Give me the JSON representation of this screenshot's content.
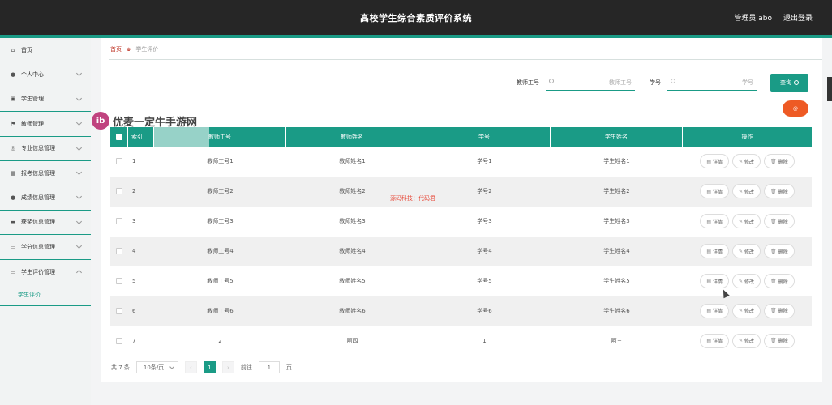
{
  "header": {
    "title": "高校学生综合素质评价系统",
    "user": "管理员 abo",
    "logout": "退出登录"
  },
  "sidebar": {
    "items": [
      {
        "label": "首页",
        "icon": "home-icon"
      },
      {
        "label": "个人中心",
        "icon": "user-icon"
      },
      {
        "label": "学生管理",
        "icon": "student-icon"
      },
      {
        "label": "教师管理",
        "icon": "flag-icon"
      },
      {
        "label": "专业信息管理",
        "icon": "compass-icon"
      },
      {
        "label": "报考信息管理",
        "icon": "grid-icon"
      },
      {
        "label": "成绩信息管理",
        "icon": "user-icon"
      },
      {
        "label": "获奖信息管理",
        "icon": "award-icon"
      },
      {
        "label": "学分信息管理",
        "icon": "monitor-icon"
      },
      {
        "label": "学生评价管理",
        "icon": "monitor-icon"
      }
    ],
    "sub_item": "学生评价"
  },
  "breadcrumb": {
    "home": "首页",
    "current": "学生评价"
  },
  "search": {
    "teacher_no_label": "教师工号",
    "teacher_no_placeholder": "教师工号",
    "student_no_label": "学号",
    "student_no_placeholder": "学号",
    "button": "查询"
  },
  "delete_button": "@",
  "watermark": {
    "logo": "ib",
    "text": "优麦一定牛手游网",
    "center": "源码科技：代码君"
  },
  "table": {
    "headers": [
      "索引",
      "教师工号",
      "教师姓名",
      "学号",
      "学生姓名",
      "操作"
    ],
    "rows": [
      [
        "1",
        "教师工号1",
        "教师姓名1",
        "学号1",
        "学生姓名1"
      ],
      [
        "2",
        "教师工号2",
        "教师姓名2",
        "学号2",
        "学生姓名2"
      ],
      [
        "3",
        "教师工号3",
        "教师姓名3",
        "学号3",
        "学生姓名3"
      ],
      [
        "4",
        "教师工号4",
        "教师姓名4",
        "学号4",
        "学生姓名4"
      ],
      [
        "5",
        "教师工号5",
        "教师姓名5",
        "学号5",
        "学生姓名5"
      ],
      [
        "6",
        "教师工号6",
        "教师姓名6",
        "学号6",
        "学生姓名6"
      ],
      [
        "7",
        "2",
        "阿四",
        "1",
        "阿三"
      ]
    ],
    "actions": {
      "detail": "详情",
      "edit": "修改",
      "delete": "删除"
    }
  },
  "pager": {
    "total": "共 7 条",
    "page_size": "10条/页",
    "prev": "‹",
    "current": "1",
    "next": "›",
    "goto_label": "前往",
    "goto_value": "1",
    "page_suffix": "页"
  },
  "colors": {
    "accent": "#1a9b86",
    "topbar": "#262626",
    "danger": "#ee5a24"
  }
}
